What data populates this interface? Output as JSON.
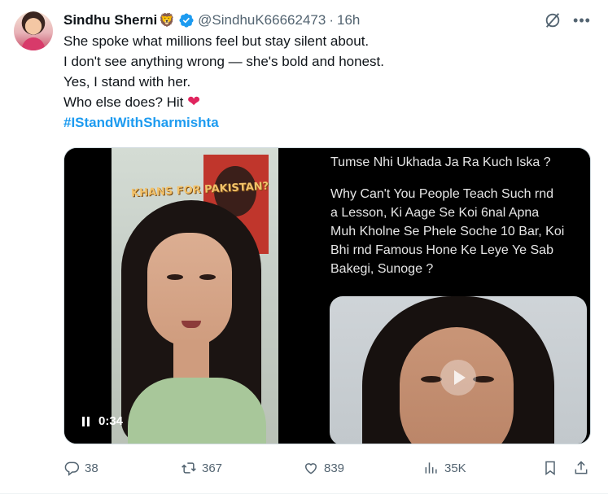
{
  "tweet": {
    "author": {
      "name": "Sindhu Sherni",
      "name_emoji": "🦁",
      "handle": "@SindhuK66662473",
      "separator": "·",
      "time": "16h"
    },
    "text_lines": [
      "She spoke what millions feel but stay silent about.",
      "I don't see anything wrong — she's bold and honest.",
      "Yes, I stand with her.",
      "Who else does? Hit"
    ],
    "heart_emoji": "❤",
    "hashtag": "#IStandWithSharmishta",
    "media": {
      "video": {
        "caption": "KHANS FOR PAKISTAN?",
        "duration": "0:34"
      },
      "image_text": {
        "line1": "Tumse Nhi Ukhada Ja Ra Kuch Iska ?",
        "para": [
          "Why Can't You People Teach Such rnd",
          "a Lesson, Ki Aage Se Koi 6nal Apna",
          "Muh Kholne Se Phele Soche 10 Bar, Koi",
          "Bhi rnd Famous Hone Ke Leye Ye Sab",
          "Bakegi, Sunoge ?"
        ]
      }
    },
    "actions": {
      "replies": "38",
      "reposts": "367",
      "likes": "839",
      "views": "35K"
    }
  },
  "colors": {
    "accent": "#1d9bf0",
    "muted": "#536471",
    "text": "#0f1419",
    "heart": "#e0245e"
  },
  "icons": [
    "verified-badge-icon",
    "grok-icon",
    "more-icon",
    "pause-icon",
    "play-icon",
    "reply-icon",
    "repost-icon",
    "like-icon",
    "views-icon",
    "bookmark-icon",
    "share-icon"
  ]
}
